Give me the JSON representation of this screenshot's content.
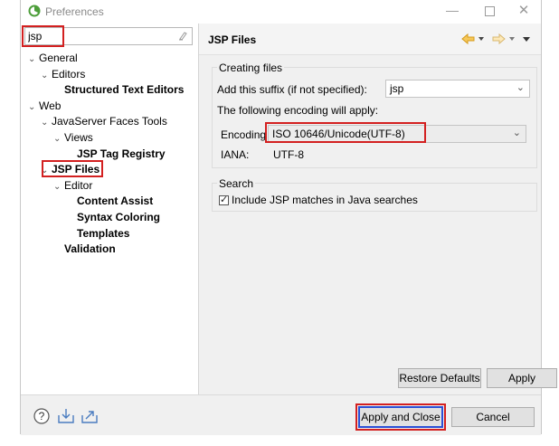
{
  "window": {
    "title": "Preferences",
    "min_glyph": "—",
    "close_glyph": "✕"
  },
  "filter": {
    "value": "jsp",
    "clear_icon": "clear-filter-icon"
  },
  "tree": [
    {
      "label": "General",
      "level": 0,
      "expanded": true,
      "bold": false
    },
    {
      "label": "Editors",
      "level": 1,
      "expanded": true,
      "bold": false
    },
    {
      "label": "Structured Text Editors",
      "level": 2,
      "leaf": true,
      "bold": true
    },
    {
      "label": "Web",
      "level": 0,
      "expanded": true,
      "bold": false
    },
    {
      "label": "JavaServer Faces Tools",
      "level": 1,
      "expanded": true,
      "bold": false
    },
    {
      "label": "Views",
      "level": 2,
      "expanded": true,
      "bold": false
    },
    {
      "label": "JSP Tag Registry",
      "level": 3,
      "leaf": true,
      "bold": true
    },
    {
      "label": "JSP Files",
      "level": 1,
      "expanded": true,
      "bold": true,
      "selected": true
    },
    {
      "label": "Editor",
      "level": 2,
      "expanded": true,
      "bold": false
    },
    {
      "label": "Content Assist",
      "level": 3,
      "leaf": true,
      "bold": true
    },
    {
      "label": "Syntax Coloring",
      "level": 3,
      "leaf": true,
      "bold": true
    },
    {
      "label": "Templates",
      "level": 3,
      "leaf": true,
      "bold": true
    },
    {
      "label": "Validation",
      "level": 2,
      "leaf": true,
      "bold": true
    }
  ],
  "page": {
    "title": "JSP Files",
    "creating_files": {
      "legend": "Creating files",
      "suffix_label": "Add this suffix (if not specified):",
      "suffix_value": "jsp",
      "encoding_note": "The following encoding will apply:",
      "encoding_label": "Encoding",
      "encoding_value": "ISO 10646/Unicode(UTF-8)",
      "iana_label": "IANA:",
      "iana_value": "UTF-8"
    },
    "search": {
      "legend": "Search",
      "include_label": "Include JSP matches in Java searches",
      "include_checked": true
    },
    "restore_defaults": "Restore Defaults",
    "apply": "Apply"
  },
  "bottom": {
    "apply_and_close": "Apply and Close",
    "cancel": "Cancel",
    "help_glyph": "?"
  },
  "colors": {
    "highlight_red": "#d32020",
    "highlight_blue": "#2a4fd6",
    "nav_arrow": "#e8a100"
  }
}
